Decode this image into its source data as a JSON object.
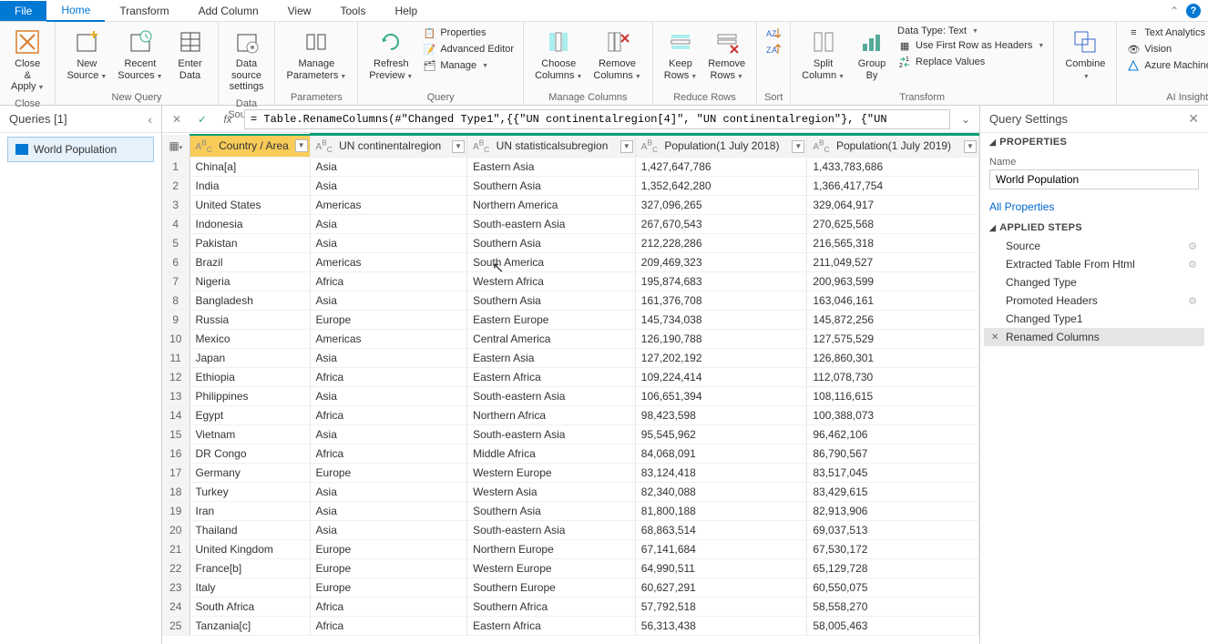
{
  "menus": {
    "file": "File",
    "home": "Home",
    "transform": "Transform",
    "addcol": "Add Column",
    "view": "View",
    "tools": "Tools",
    "help": "Help"
  },
  "ribbon": {
    "close": {
      "l1": "Close &",
      "l2": "Apply",
      "g": "Close"
    },
    "new": {
      "l1": "New",
      "l2": "Source"
    },
    "recent": {
      "l1": "Recent",
      "l2": "Sources"
    },
    "enter": {
      "l1": "Enter",
      "l2": "Data"
    },
    "newquery_g": "New Query",
    "ds": {
      "l1": "Data source",
      "l2": "settings"
    },
    "ds_g": "Data Sources",
    "params": {
      "l1": "Manage",
      "l2": "Parameters"
    },
    "params_g": "Parameters",
    "refresh": {
      "l1": "Refresh",
      "l2": "Preview"
    },
    "props": "Properties",
    "adv": "Advanced Editor",
    "manage": "Manage",
    "query_g": "Query",
    "choose": {
      "l1": "Choose",
      "l2": "Columns"
    },
    "remove": {
      "l1": "Remove",
      "l2": "Columns"
    },
    "mcols_g": "Manage Columns",
    "keepr": {
      "l1": "Keep",
      "l2": "Rows"
    },
    "remover": {
      "l1": "Remove",
      "l2": "Rows"
    },
    "rrows_g": "Reduce Rows",
    "sort_g": "Sort",
    "split": {
      "l1": "Split",
      "l2": "Column"
    },
    "group": {
      "l1": "Group",
      "l2": "By"
    },
    "dtype": "Data Type: Text",
    "firstrow": "Use First Row as Headers",
    "replace": "Replace Values",
    "trans_g": "Transform",
    "combine": "Combine",
    "ta": "Text Analytics",
    "vision": "Vision",
    "aml": "Azure Machine Learning",
    "ai_g": "AI Insights"
  },
  "queries_title": "Queries [1]",
  "query_name": "World Population",
  "formula": "= Table.RenameColumns(#\"Changed Type1\",{{\"UN continentalregion[4]\", \"UN continentalregion\"}, {\"UN",
  "columns": [
    "Country / Area",
    "UN continentalregion",
    "UN statisticalsubregion",
    "Population(1 July 2018)",
    "Population(1 July 2019)"
  ],
  "rows": [
    [
      "China[a]",
      "Asia",
      "Eastern Asia",
      "1,427,647,786",
      "1,433,783,686"
    ],
    [
      "India",
      "Asia",
      "Southern Asia",
      "1,352,642,280",
      "1,366,417,754"
    ],
    [
      "United States",
      "Americas",
      "Northern America",
      "327,096,265",
      "329,064,917"
    ],
    [
      "Indonesia",
      "Asia",
      "South-eastern Asia",
      "267,670,543",
      "270,625,568"
    ],
    [
      "Pakistan",
      "Asia",
      "Southern Asia",
      "212,228,286",
      "216,565,318"
    ],
    [
      "Brazil",
      "Americas",
      "South America",
      "209,469,323",
      "211,049,527"
    ],
    [
      "Nigeria",
      "Africa",
      "Western Africa",
      "195,874,683",
      "200,963,599"
    ],
    [
      "Bangladesh",
      "Asia",
      "Southern Asia",
      "161,376,708",
      "163,046,161"
    ],
    [
      "Russia",
      "Europe",
      "Eastern Europe",
      "145,734,038",
      "145,872,256"
    ],
    [
      "Mexico",
      "Americas",
      "Central America",
      "126,190,788",
      "127,575,529"
    ],
    [
      "Japan",
      "Asia",
      "Eastern Asia",
      "127,202,192",
      "126,860,301"
    ],
    [
      "Ethiopia",
      "Africa",
      "Eastern Africa",
      "109,224,414",
      "112,078,730"
    ],
    [
      "Philippines",
      "Asia",
      "South-eastern Asia",
      "106,651,394",
      "108,116,615"
    ],
    [
      "Egypt",
      "Africa",
      "Northern Africa",
      "98,423,598",
      "100,388,073"
    ],
    [
      "Vietnam",
      "Asia",
      "South-eastern Asia",
      "95,545,962",
      "96,462,106"
    ],
    [
      "DR Congo",
      "Africa",
      "Middle Africa",
      "84,068,091",
      "86,790,567"
    ],
    [
      "Germany",
      "Europe",
      "Western Europe",
      "83,124,418",
      "83,517,045"
    ],
    [
      "Turkey",
      "Asia",
      "Western Asia",
      "82,340,088",
      "83,429,615"
    ],
    [
      "Iran",
      "Asia",
      "Southern Asia",
      "81,800,188",
      "82,913,906"
    ],
    [
      "Thailand",
      "Asia",
      "South-eastern Asia",
      "68,863,514",
      "69,037,513"
    ],
    [
      "United Kingdom",
      "Europe",
      "Northern Europe",
      "67,141,684",
      "67,530,172"
    ],
    [
      "France[b]",
      "Europe",
      "Western Europe",
      "64,990,511",
      "65,129,728"
    ],
    [
      "Italy",
      "Europe",
      "Southern Europe",
      "60,627,291",
      "60,550,075"
    ],
    [
      "South Africa",
      "Africa",
      "Southern Africa",
      "57,792,518",
      "58,558,270"
    ],
    [
      "Tanzania[c]",
      "Africa",
      "Eastern Africa",
      "56,313,438",
      "58,005,463"
    ]
  ],
  "settings": {
    "title": "Query Settings",
    "props": "PROPERTIES",
    "name_lbl": "Name",
    "allprops": "All Properties",
    "applied": "APPLIED STEPS",
    "steps": [
      "Source",
      "Extracted Table From Html",
      "Changed Type",
      "Promoted Headers",
      "Changed Type1",
      "Renamed Columns"
    ]
  }
}
